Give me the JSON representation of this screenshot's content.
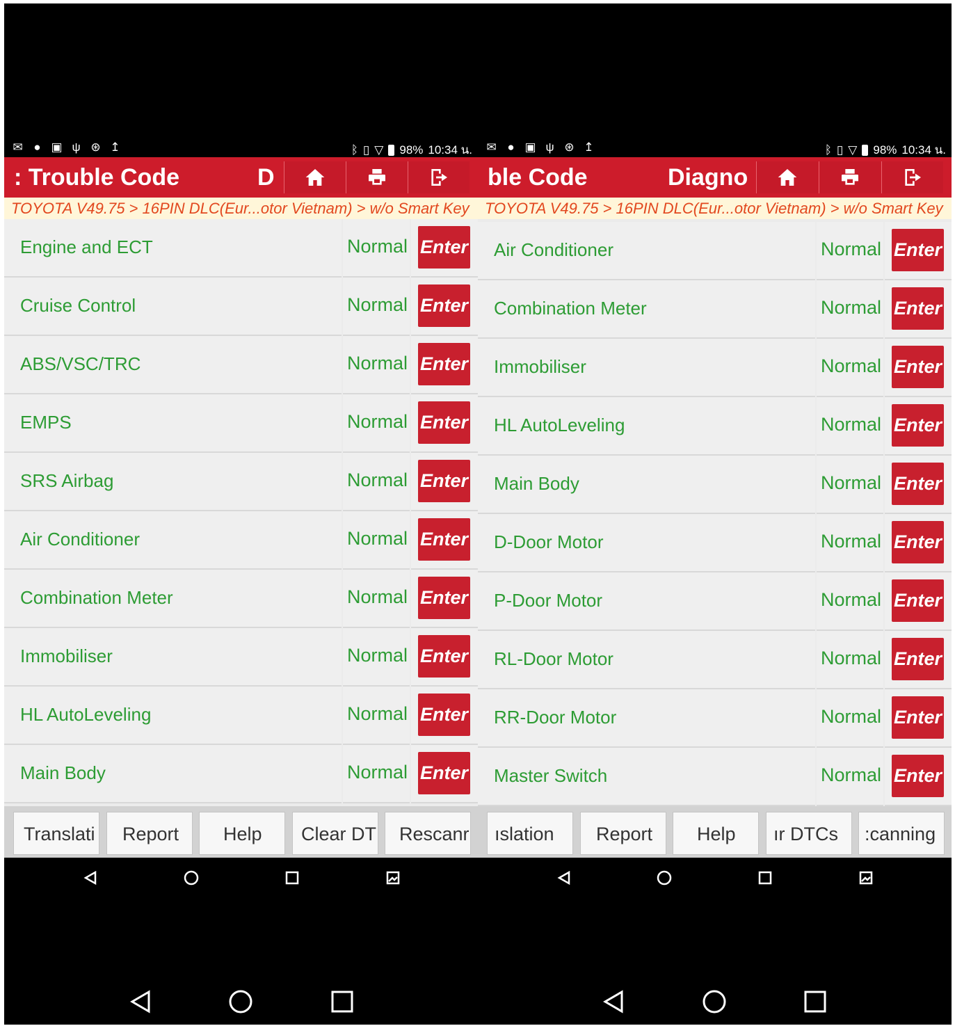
{
  "status_bar": {
    "battery": "98%",
    "time": "10:34 น.",
    "left_icons": [
      "gmail-icon",
      "messenger-icon",
      "photo-icon",
      "usb-icon",
      "bluetooth-circle-icon",
      "upload-icon"
    ],
    "right_icons": [
      "bluetooth-icon",
      "vibrate-icon",
      "wifi-icon",
      "battery-icon"
    ]
  },
  "left_panel": {
    "title": ": Trouble Code",
    "title_tail": "D",
    "breadcrumb": "TOYOTA V49.75 > 16PIN DLC(Eur...otor Vietnam) > w/o Smart Key",
    "rows": [
      {
        "name": "Engine and ECT",
        "status": "Normal",
        "button": "Enter"
      },
      {
        "name": "Cruise Control",
        "status": "Normal",
        "button": "Enter"
      },
      {
        "name": "ABS/VSC/TRC",
        "status": "Normal",
        "button": "Enter"
      },
      {
        "name": "EMPS",
        "status": "Normal",
        "button": "Enter"
      },
      {
        "name": "SRS Airbag",
        "status": "Normal",
        "button": "Enter"
      },
      {
        "name": "Air Conditioner",
        "status": "Normal",
        "button": "Enter"
      },
      {
        "name": "Combination Meter",
        "status": "Normal",
        "button": "Enter"
      },
      {
        "name": "Immobiliser",
        "status": "Normal",
        "button": "Enter"
      },
      {
        "name": "HL AutoLeveling",
        "status": "Normal",
        "button": "Enter"
      },
      {
        "name": "Main Body",
        "status": "Normal",
        "button": "Enter"
      }
    ],
    "bottom_buttons": [
      "Translati",
      "Report",
      "Help",
      "Clear DT",
      "Rescanr"
    ]
  },
  "right_panel": {
    "title": "ble Code",
    "title_tail": "Diagno",
    "breadcrumb": "TOYOTA V49.75 > 16PIN DLC(Eur...otor Vietnam) > w/o Smart Key",
    "rows": [
      {
        "name": "Air Conditioner",
        "status": "Normal",
        "button": "Enter"
      },
      {
        "name": "Combination Meter",
        "status": "Normal",
        "button": "Enter"
      },
      {
        "name": "Immobiliser",
        "status": "Normal",
        "button": "Enter"
      },
      {
        "name": "HL AutoLeveling",
        "status": "Normal",
        "button": "Enter"
      },
      {
        "name": "Main Body",
        "status": "Normal",
        "button": "Enter"
      },
      {
        "name": "D-Door Motor",
        "status": "Normal",
        "button": "Enter"
      },
      {
        "name": "P-Door Motor",
        "status": "Normal",
        "button": "Enter"
      },
      {
        "name": "RL-Door Motor",
        "status": "Normal",
        "button": "Enter"
      },
      {
        "name": "RR-Door Motor",
        "status": "Normal",
        "button": "Enter"
      },
      {
        "name": "Master Switch",
        "status": "Normal",
        "button": "Enter"
      }
    ],
    "bottom_buttons": [
      "ıslation",
      "Report",
      "Help",
      "ır DTCs",
      ":canning"
    ]
  },
  "toolbar_icons": [
    "home-icon",
    "print-icon",
    "exit-icon"
  ],
  "nav_icons": [
    "back-icon",
    "home-circle-icon",
    "recents-icon",
    "screenshot-icon"
  ],
  "colors": {
    "accent": "#cd1c2b",
    "status_text": "#2d9c34",
    "breadcrumb_text": "#e2481f"
  }
}
